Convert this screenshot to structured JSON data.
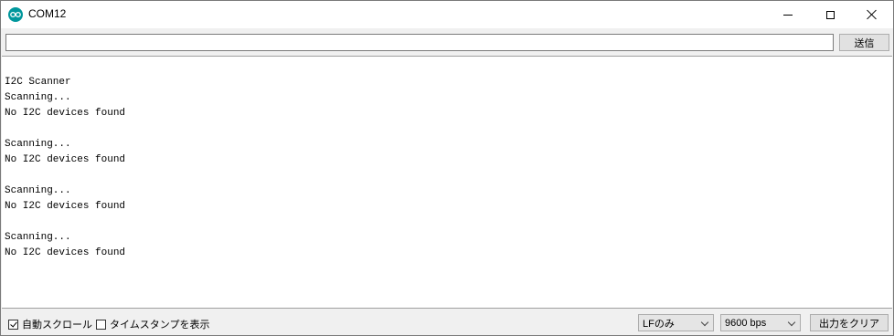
{
  "window": {
    "title": "COM12",
    "icon": "arduino-icon",
    "controls": [
      "minimize-icon",
      "maximize-icon",
      "close-icon"
    ]
  },
  "send": {
    "input_value": "",
    "button_label": "送信"
  },
  "output": {
    "lines": [
      "I2C Scanner",
      "Scanning...",
      "No I2C devices found",
      "",
      "Scanning...",
      "No I2C devices found",
      "",
      "Scanning...",
      "No I2C devices found",
      "",
      "Scanning...",
      "No I2C devices found"
    ]
  },
  "footer": {
    "autoscroll_label": "自動スクロール",
    "autoscroll_checked": true,
    "timestamp_label": "タイムスタンプを表示",
    "timestamp_checked": false,
    "line_ending_value": "LFのみ",
    "baud_value": "9600 bps",
    "clear_button_label": "出力をクリア"
  },
  "colors": {
    "accent": "#00979c",
    "window_bg": "#f0f0f0",
    "output_bg": "#ffffff"
  }
}
